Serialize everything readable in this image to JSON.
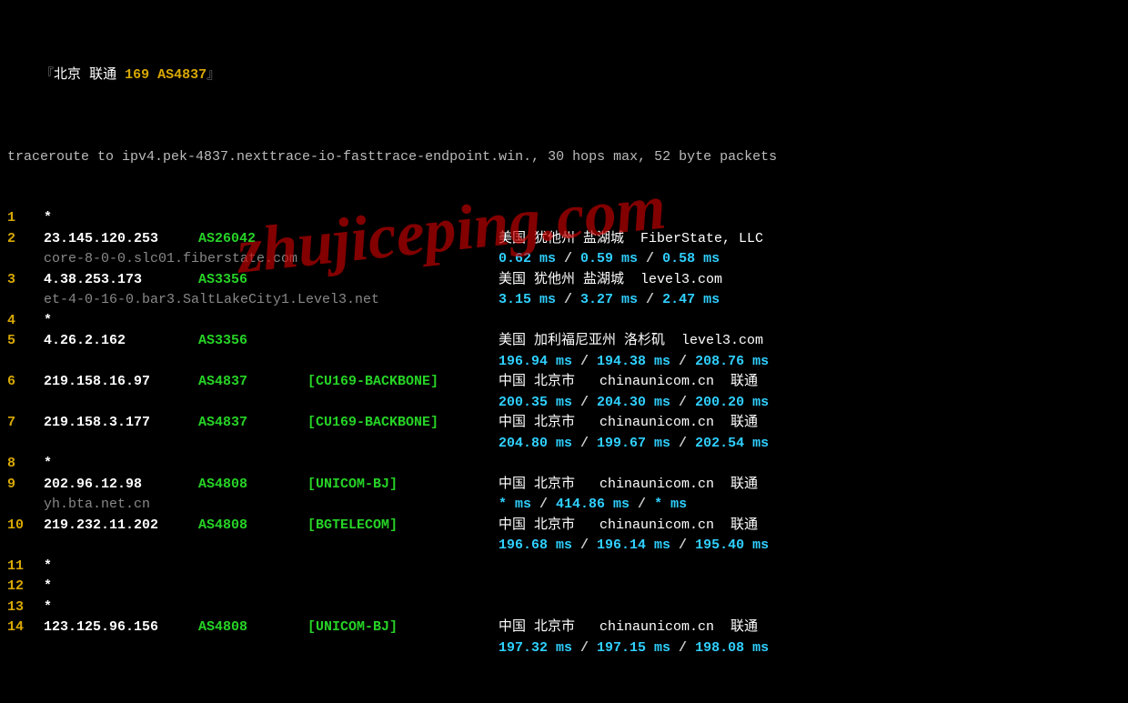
{
  "header": {
    "open": "『",
    "city": "北京",
    "isp": "联通",
    "tag": "169 AS4837",
    "close": "』"
  },
  "cmdline": "traceroute to ipv4.pek-4837.nexttrace-io-fasttrace-endpoint.win., 30 hops max, 52 byte packets",
  "watermark": "zhujiceping.com",
  "hops": [
    {
      "n": "1",
      "star": "*"
    },
    {
      "n": "2",
      "ip": "23.145.120.253",
      "asn": "AS26042",
      "tag": "",
      "loc": "美国 犹他州 盐湖城  FiberState, LLC",
      "host": "core-8-0-0.slc01.fiberstate.com",
      "rtt": [
        "0.62 ms",
        "0.59 ms",
        "0.58 ms"
      ]
    },
    {
      "n": "3",
      "ip": "4.38.253.173",
      "asn": "AS3356",
      "tag": "",
      "loc": "美国 犹他州 盐湖城  level3.com",
      "host": "et-4-0-16-0.bar3.SaltLakeCity1.Level3.net",
      "rtt": [
        "3.15 ms",
        "3.27 ms",
        "2.47 ms"
      ]
    },
    {
      "n": "4",
      "star": "*"
    },
    {
      "n": "5",
      "ip": "4.26.2.162",
      "asn": "AS3356",
      "tag": "",
      "loc": "美国 加利福尼亚州 洛杉矶  level3.com",
      "host": "",
      "rtt": [
        "196.94 ms",
        "194.38 ms",
        "208.76 ms"
      ]
    },
    {
      "n": "6",
      "ip": "219.158.16.97",
      "asn": "AS4837",
      "tag": "[CU169-BACKBONE]",
      "loc": "中国 北京市   chinaunicom.cn  联通",
      "host": "",
      "rtt": [
        "200.35 ms",
        "204.30 ms",
        "200.20 ms"
      ]
    },
    {
      "n": "7",
      "ip": "219.158.3.177",
      "asn": "AS4837",
      "tag": "[CU169-BACKBONE]",
      "loc": "中国 北京市   chinaunicom.cn  联通",
      "host": "",
      "rtt": [
        "204.80 ms",
        "199.67 ms",
        "202.54 ms"
      ]
    },
    {
      "n": "8",
      "star": "*"
    },
    {
      "n": "9",
      "ip": "202.96.12.98",
      "asn": "AS4808",
      "tag": "[UNICOM-BJ]",
      "loc": "中国 北京市   chinaunicom.cn  联通",
      "host": "yh.bta.net.cn",
      "rtt": [
        "* ms",
        "414.86 ms",
        "* ms"
      ]
    },
    {
      "n": "10",
      "ip": "219.232.11.202",
      "asn": "AS4808",
      "tag": "[BGTELECOM]",
      "loc": "中国 北京市   chinaunicom.cn  联通",
      "host": "",
      "rtt": [
        "196.68 ms",
        "196.14 ms",
        "195.40 ms"
      ]
    },
    {
      "n": "11",
      "star": "*"
    },
    {
      "n": "12",
      "star": "*"
    },
    {
      "n": "13",
      "star": "*"
    },
    {
      "n": "14",
      "ip": "123.125.96.156",
      "asn": "AS4808",
      "tag": "[UNICOM-BJ]",
      "loc": "中国 北京市   chinaunicom.cn  联通",
      "host": "",
      "rtt": [
        "197.32 ms",
        "197.15 ms",
        "198.08 ms"
      ]
    }
  ]
}
